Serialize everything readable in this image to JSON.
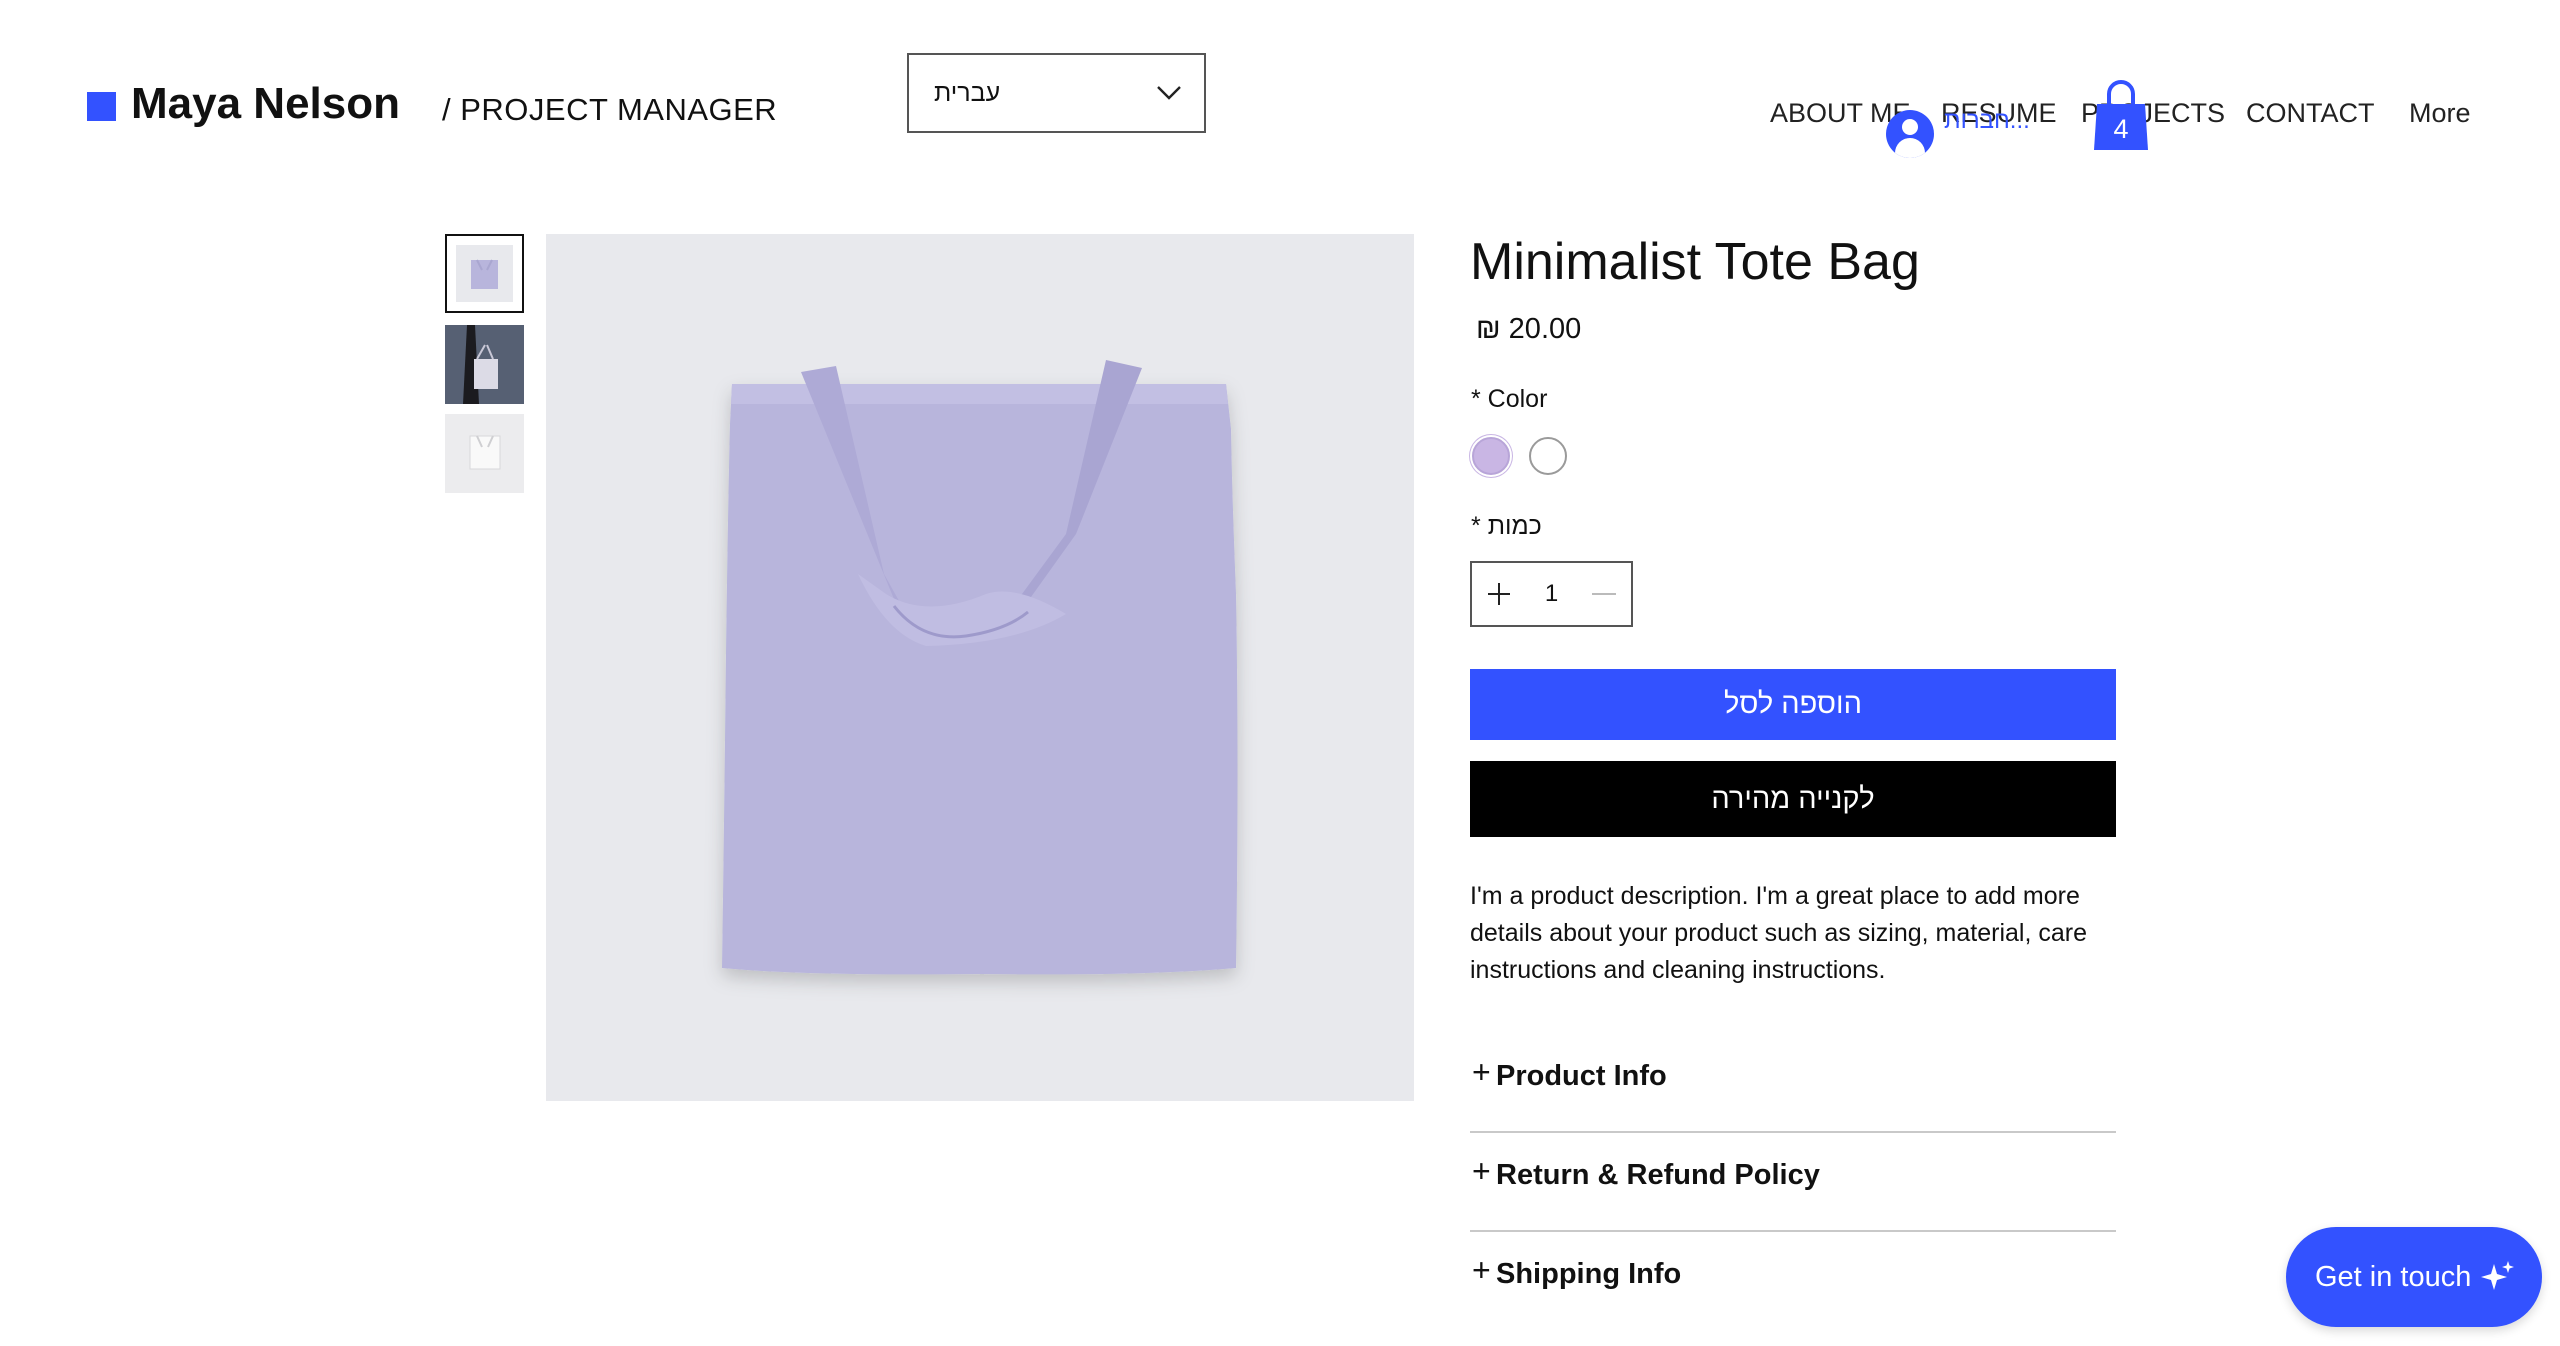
{
  "header": {
    "site_name": "Maya Nelson",
    "role": "/  PROJECT MANAGER",
    "language": {
      "selected": "עברית"
    },
    "nav": [
      "ABOUT ME",
      "RESUME",
      "PROJECTS",
      "CONTACT",
      "More"
    ],
    "login_label": "חברות...",
    "cart_count": "4"
  },
  "gallery": {
    "thumbnails": [
      "lavender-tote",
      "model-tote",
      "white-tote"
    ],
    "selected_index": 0
  },
  "product": {
    "title": "Minimalist Tote Bag",
    "price": "₪ 20.00",
    "color_label": "* Color",
    "colors": [
      {
        "name": "lavender",
        "hex": "#c9b6e4",
        "selected": true
      },
      {
        "name": "white",
        "hex": "#ffffff",
        "selected": false
      }
    ],
    "quantity_label": "* כמות",
    "quantity": "1",
    "add_to_cart": "הוספה לסל",
    "buy_now": "לקנייה מהירה",
    "description": "I'm a product description. I'm a great place to add more details about your product such as sizing, material, care instructions and cleaning instructions.",
    "sections": [
      "Product Info",
      "Return & Refund Policy",
      "Shipping Info"
    ]
  },
  "chat": {
    "label": "Get in touch"
  },
  "colors": {
    "accent": "#3352ff",
    "image_bg": "#e8e9ed",
    "bag": "#b8b5dc"
  }
}
